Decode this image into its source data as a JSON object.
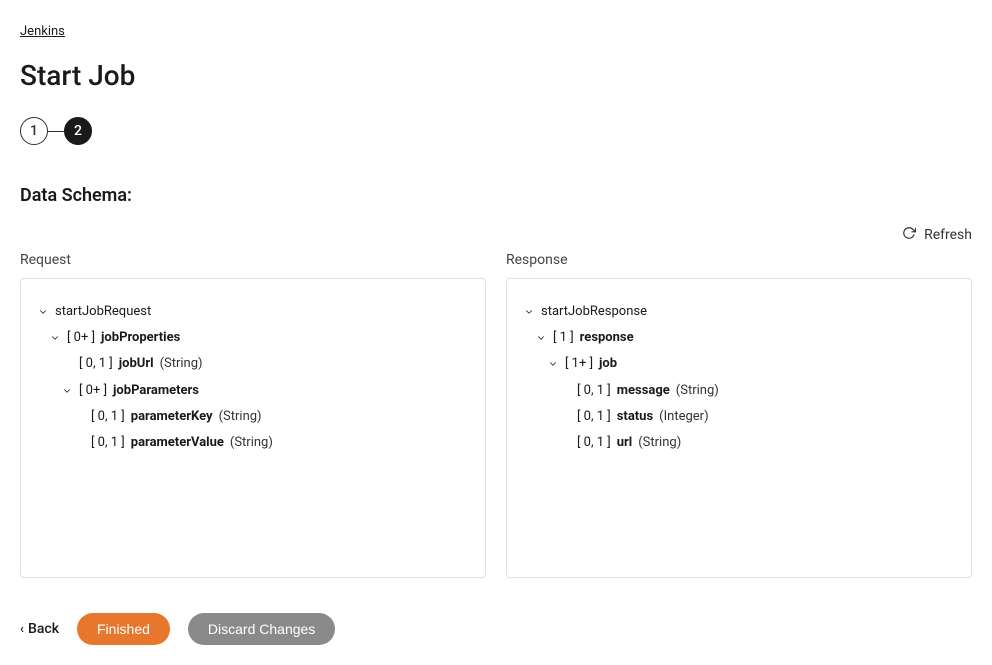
{
  "breadcrumb": {
    "label": "Jenkins"
  },
  "page": {
    "title": "Start Job"
  },
  "stepper": {
    "step1": "1",
    "step2": "2"
  },
  "section": {
    "title": "Data Schema:"
  },
  "refresh": {
    "label": "Refresh"
  },
  "columns": {
    "request": "Request",
    "response": "Response"
  },
  "request_tree": {
    "root": {
      "name": "startJobRequest"
    },
    "jobProperties": {
      "cardinality": "[ 0+ ]",
      "name": "jobProperties"
    },
    "jobUrl": {
      "cardinality": "[ 0, 1 ]",
      "name": "jobUrl",
      "type": "(String)"
    },
    "jobParameters": {
      "cardinality": "[ 0+ ]",
      "name": "jobParameters"
    },
    "parameterKey": {
      "cardinality": "[ 0, 1 ]",
      "name": "parameterKey",
      "type": "(String)"
    },
    "parameterValue": {
      "cardinality": "[ 0, 1 ]",
      "name": "parameterValue",
      "type": "(String)"
    }
  },
  "response_tree": {
    "root": {
      "name": "startJobResponse"
    },
    "response": {
      "cardinality": "[ 1 ]",
      "name": "response"
    },
    "job": {
      "cardinality": "[ 1+ ]",
      "name": "job"
    },
    "message": {
      "cardinality": "[ 0, 1 ]",
      "name": "message",
      "type": "(String)"
    },
    "status": {
      "cardinality": "[ 0, 1 ]",
      "name": "status",
      "type": "(Integer)"
    },
    "url": {
      "cardinality": "[ 0, 1 ]",
      "name": "url",
      "type": "(String)"
    }
  },
  "footer": {
    "back": "Back",
    "finished": "Finished",
    "discard": "Discard Changes"
  }
}
